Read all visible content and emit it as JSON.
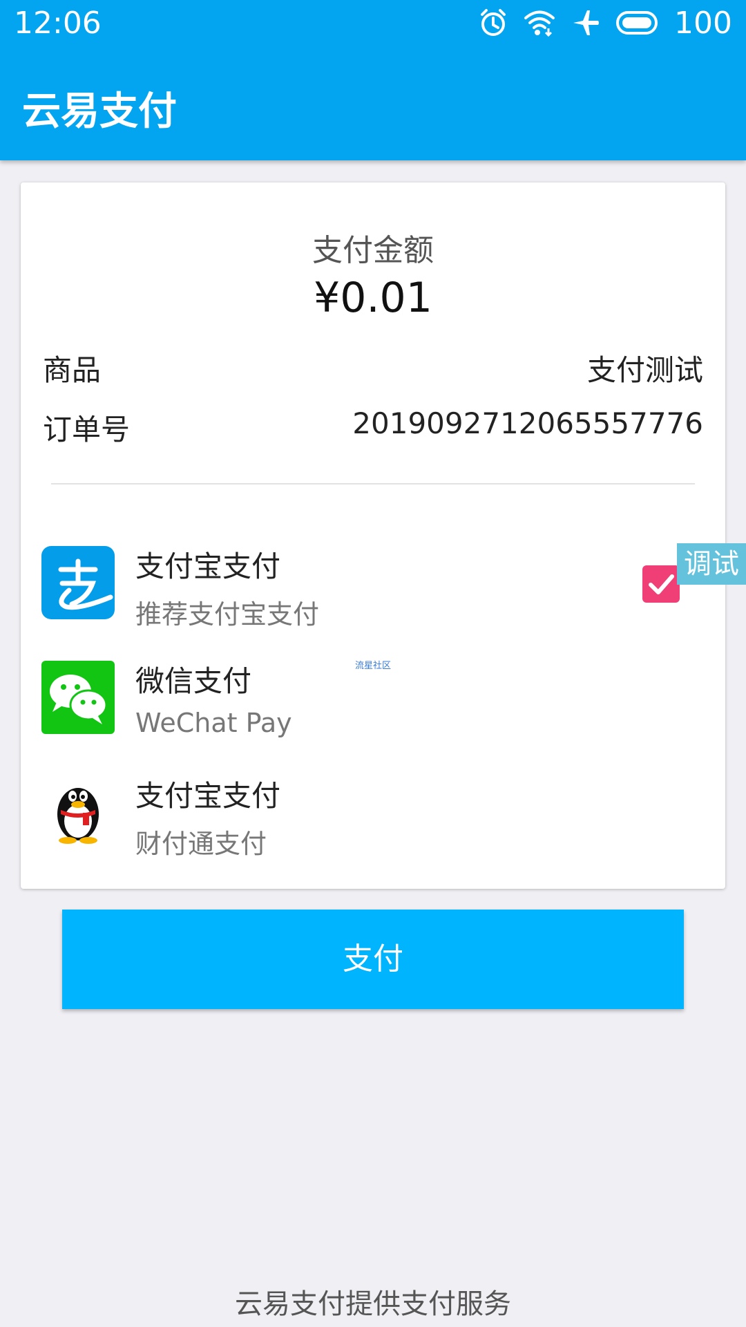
{
  "status_bar": {
    "time": "12:06",
    "battery_level": "100",
    "icons": [
      "alarm-icon",
      "wifi-icon",
      "airplane-mode-icon",
      "battery-icon"
    ]
  },
  "app_bar": {
    "title": "云易支付"
  },
  "order": {
    "amount_label": "支付金额",
    "amount_value": "¥0.01",
    "product_label": "商品",
    "product_value": "支付测试",
    "order_no_label": "订单号",
    "order_no_value": "2019092712065557776"
  },
  "payment_methods": [
    {
      "title": "支付宝支付",
      "subtitle": "推荐支付宝支付",
      "icon": "alipay-icon",
      "selected": true
    },
    {
      "title": "微信支付",
      "subtitle": "WeChat Pay",
      "icon": "wechat-icon",
      "selected": false
    },
    {
      "title": "支付宝支付",
      "subtitle": "财付通支付",
      "icon": "qq-penguin-icon",
      "selected": false
    }
  ],
  "debug_tag": "调试",
  "watermark": "流星社区",
  "pay_button": "支付",
  "footer": "云易支付提供支付服务",
  "colors": {
    "app_bar": "#03a4f0",
    "pay_button": "#00b4fd",
    "checkbox": "#ef3f76",
    "debug_tag": "#64c2dc",
    "background": "#efeff4"
  }
}
